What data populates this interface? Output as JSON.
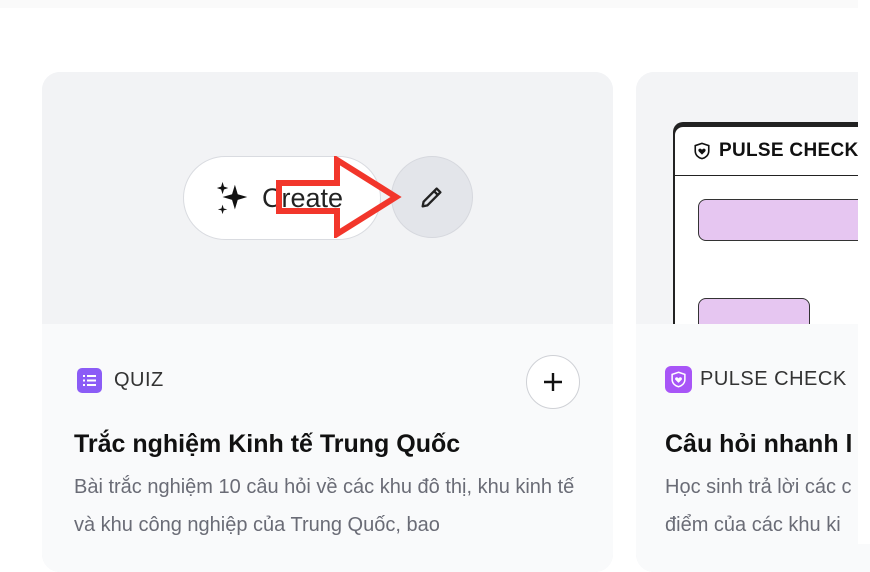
{
  "cards": [
    {
      "create_label": "Create",
      "type_label": "QUIZ",
      "title": "Trắc nghiệm Kinh tế Trung Quốc",
      "description": "Bài trắc nghiệm 10 câu hỏi về các khu đô thị, khu kinh tế và khu công nghiệp của Trung Quốc, bao"
    },
    {
      "preview_header": "PULSE CHECK",
      "type_label": "PULSE CHECK",
      "title": "Câu hỏi nhanh l",
      "description": "Học sinh trả lời các c điểm của các khu ki"
    }
  ],
  "colors": {
    "quiz_icon": "#8b5cf6",
    "pulse_icon": "#a855f7",
    "annotation_arrow": "#f2362b",
    "bar_fill": "#e6c6f1"
  },
  "icons": {
    "create": "sparkles-icon",
    "edit": "pencil-icon",
    "add": "plus-icon",
    "quiz": "list-icon",
    "pulse": "heart-shield-icon"
  }
}
